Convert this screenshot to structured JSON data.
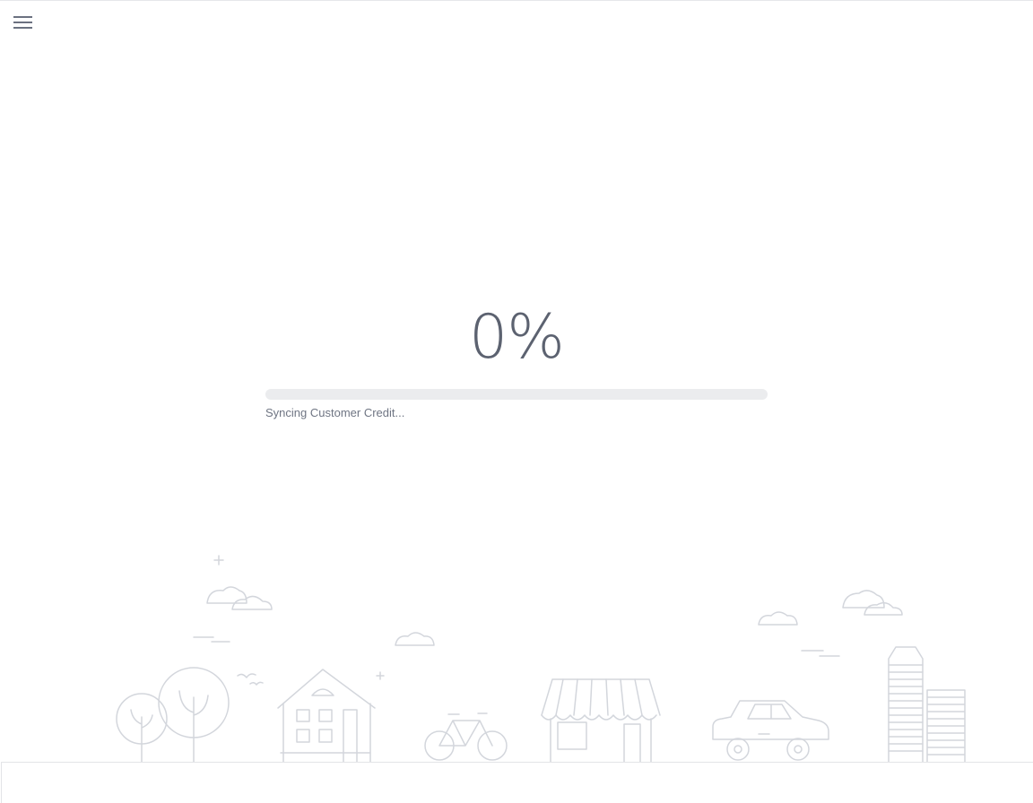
{
  "header": {
    "menu_icon": "hamburger-menu-icon"
  },
  "sync": {
    "percent_text": "0%",
    "progress_fraction": 0,
    "status_text": "Syncing Customer Credit..."
  },
  "illustration": {
    "icons": [
      "tree-icon",
      "house-icon",
      "bicycle-icon",
      "storefront-icon",
      "car-icon",
      "building-icon",
      "cloud-icon",
      "bird-icon"
    ]
  },
  "colors": {
    "text_primary": "#5c6270",
    "progress_track": "#ebecee",
    "line_art": "#d3d6dc"
  }
}
